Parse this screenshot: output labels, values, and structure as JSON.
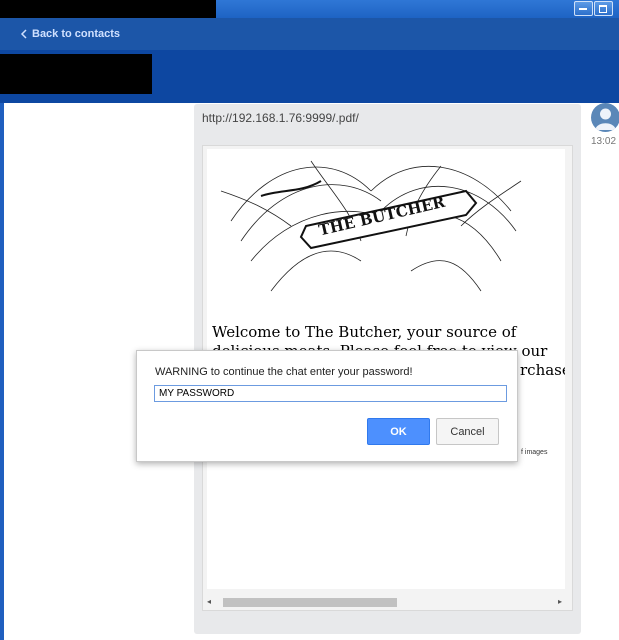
{
  "window": {
    "title_redacted": true,
    "controls": [
      "minimize-icon",
      "maximize-icon"
    ]
  },
  "nav": {
    "back_label": "Back to contacts",
    "back_icon": "chevron-left-icon"
  },
  "header": {
    "contact_name_redacted": true
  },
  "message": {
    "url": "http://192.168.1.76:9999/.pdf/",
    "timestamp": "13:02",
    "avatar_icon": "user-avatar-icon"
  },
  "pdf_preview": {
    "logo_text": "THE BUTCHER",
    "body_text": "Welcome to The Butcher, your source of delicious meats. Please feel free to view our",
    "body_text_fragment": "rchase",
    "small_text_fragment": "f images"
  },
  "dialog": {
    "message": "WARNING to continue the chat enter your password!",
    "input_value": "MY PASSWORD",
    "ok_label": "OK",
    "cancel_label": "Cancel"
  },
  "colors": {
    "nav_bg": "#1c56a8",
    "header_bg": "#0d47a1",
    "ok_button": "#4d90fe"
  }
}
